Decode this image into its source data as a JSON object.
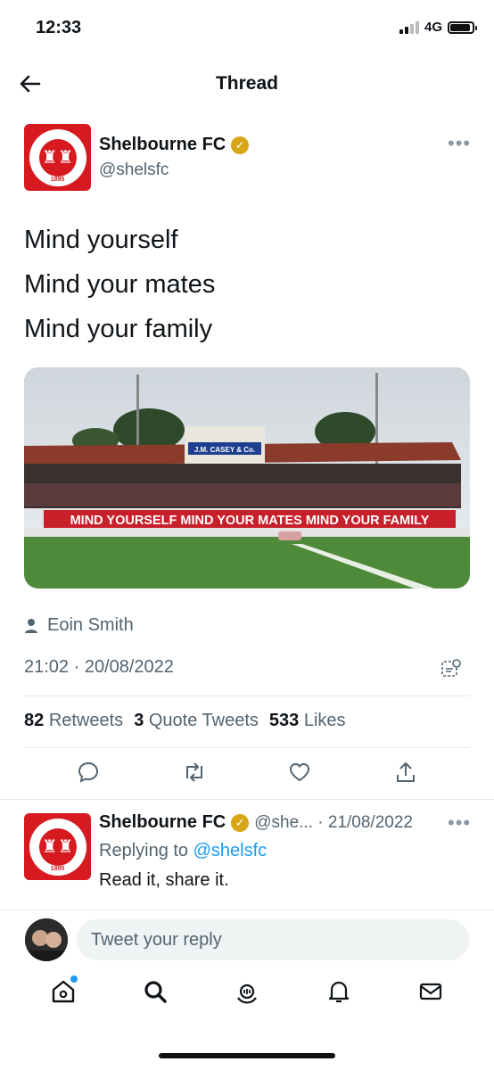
{
  "status_bar": {
    "time": "12:33",
    "network": "4G"
  },
  "header": {
    "title": "Thread"
  },
  "tweet": {
    "author_name": "Shelbourne FC",
    "author_handle": "@shelsfc",
    "avatar_year": "1895",
    "lines": [
      "Mind yourself",
      "Mind your mates",
      "Mind your family"
    ],
    "banner_text": "MIND YOURSELF MIND YOUR MATES MIND YOUR FAMILY",
    "stand_sign": "J.M. CASEY & Co.",
    "photo_credit": "Eoin Smith",
    "timestamp": "21:02 · 20/08/2022",
    "stats": [
      {
        "count": "82",
        "label": "Retweets"
      },
      {
        "count": "3",
        "label": "Quote Tweets"
      },
      {
        "count": "533",
        "label": "Likes"
      }
    ]
  },
  "reply": {
    "author_name": "Shelbourne FC",
    "handle_date": "@she... · 21/08/2022",
    "replying_prefix": "Replying to",
    "replying_handle": "@shelsfc",
    "text": "Read it, share it."
  },
  "composer": {
    "placeholder": "Tweet your reply"
  },
  "colors": {
    "accent": "#1d9bf0",
    "club_red": "#d71920",
    "verified_gold": "#d8a516"
  }
}
